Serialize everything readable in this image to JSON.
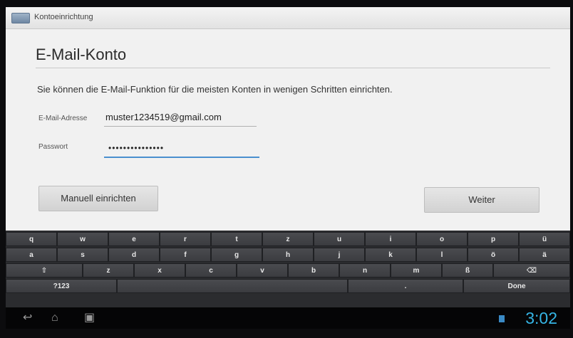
{
  "actionbar": {
    "title": "Kontoeinrichtung"
  },
  "form": {
    "heading": "E-Mail-Konto",
    "description": "Sie können die E-Mail-Funktion für die meisten Konten in wenigen Schritten einrichten.",
    "email_label": "E-Mail-Adresse",
    "email_value": "muster1234519@gmail.com",
    "password_label": "Passwort",
    "password_value": "•••••••••••••••",
    "manual_button": "Manuell einrichten",
    "next_button": "Weiter"
  },
  "keyboard": {
    "row1": [
      "q",
      "w",
      "e",
      "r",
      "t",
      "z",
      "u",
      "i",
      "o",
      "p",
      "ü"
    ],
    "row2": [
      "a",
      "s",
      "d",
      "f",
      "g",
      "h",
      "j",
      "k",
      "l",
      "ö",
      "ä"
    ],
    "row3": [
      "⇧",
      "z",
      "x",
      "c",
      "v",
      "b",
      "n",
      "m",
      "ß",
      "⌫"
    ],
    "row3_shift_label": "⇧",
    "row3_del_label": "⌫",
    "row4_symbols": "?123",
    "row4_space": "",
    "row4_dot": ".",
    "row4_done": "Done"
  },
  "navbar": {
    "back_icon": "back-icon",
    "home_icon": "home-icon",
    "recents_icon": "recents-icon",
    "time": "3:02"
  }
}
